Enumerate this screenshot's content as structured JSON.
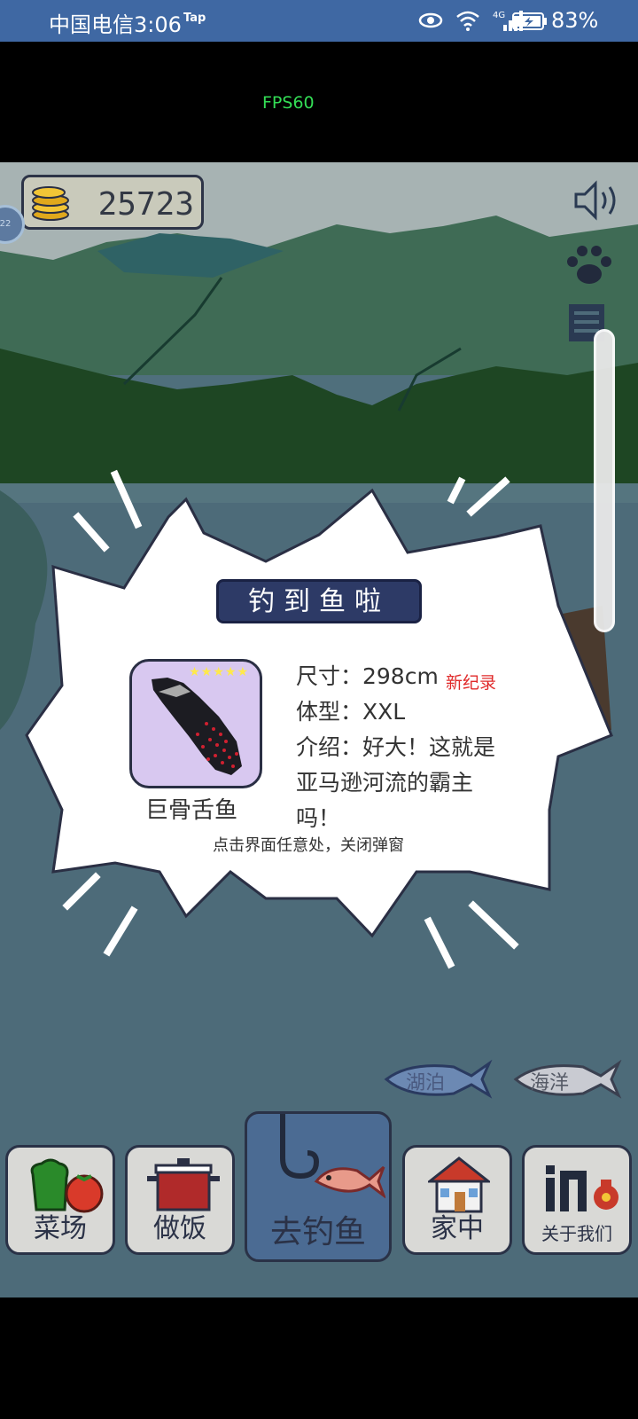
{
  "status_bar": {
    "carrier": "中国电信3:06",
    "tap": "Tap",
    "battery_pct": "83%"
  },
  "debug": {
    "fps": "FPS60"
  },
  "hud": {
    "coins": "25723",
    "bubble_text": "22"
  },
  "popup": {
    "title": "钓到鱼啦",
    "fish_name": "巨骨舌鱼",
    "stars": "★★★★★",
    "size_line": "尺寸：298cm",
    "record_badge": "新纪录",
    "body_line": "体型：XXL",
    "intro_line1": "介绍：好大！这就是",
    "intro_line2": "亚马逊河流的霸主",
    "intro_line3": "吗！",
    "hint": "点击界面任意处，关闭弹窗"
  },
  "locations": [
    {
      "label": "湖泊"
    },
    {
      "label": "海洋"
    }
  ],
  "nav": [
    {
      "label": "菜场"
    },
    {
      "label": "做饭"
    },
    {
      "label": "去钓鱼"
    },
    {
      "label": "家中"
    },
    {
      "label": "关于我们"
    }
  ],
  "colors": {
    "statusbar": "#3f68a3",
    "popup_title_bg": "#2d3a66",
    "record": "#e02a2a",
    "fps": "#33dd55"
  }
}
